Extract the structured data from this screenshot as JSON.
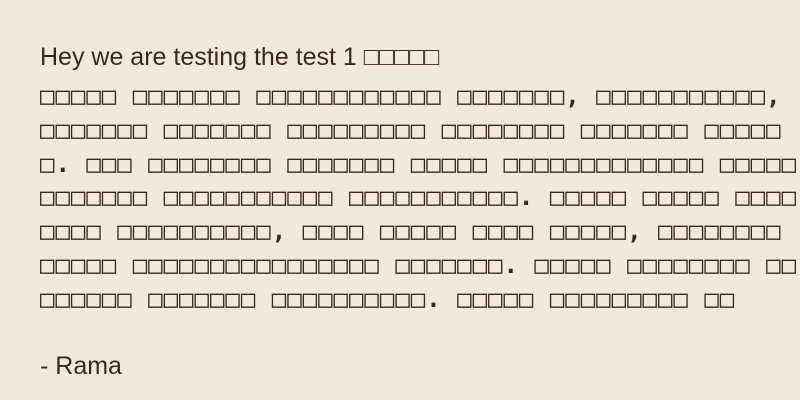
{
  "quote": {
    "title": "Hey we are testing the test  1  □□□□□",
    "body": "□□□□□ □□□□□□□ □□□□□□□□□□□□ □□□□□□□, □□□□□□□□□□□, □□□□□□□ □□□□□□□ □□□□□□□□□ □□□□□□□□ □□□□□□□ □□□□□□. □□□ □□□□□□□□ □□□□□□□ □□□□□ □□□□□□□□□□□□□ □□□□□□□□□□□□ □□□□□□□□□□□ □□□□□□□□□□□. □□□□□ □□□□□ □□□□□□□□ □□□□□□□□□□, □□□□ □□□□□ □□□□ □□□□□, □□□□□□□□ □□□□□ □□□□□□□□□□□□□□□□ □□□□□□□. □□□□□ □□□□□□□□ □□□□□□□□ □□□□□□□ □□□□□□□□□□. □□□□□ □□□□□□□□□ □□",
    "author": "- Rama"
  },
  "colors": {
    "background": "#f3e9da",
    "text": "#3b2a1c"
  }
}
